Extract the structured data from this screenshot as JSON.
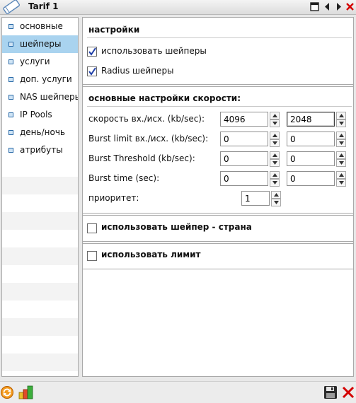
{
  "window": {
    "title": "Tarif 1",
    "icons": [
      "pencil-icon",
      "restore-icon",
      "prev-icon",
      "next-icon",
      "close-icon"
    ]
  },
  "sidebar": {
    "items": [
      {
        "label": "основные",
        "selected": false
      },
      {
        "label": "шейперы",
        "selected": true
      },
      {
        "label": "услуги",
        "selected": false
      },
      {
        "label": "доп. услуги",
        "selected": false
      },
      {
        "label": "NAS шейперы",
        "selected": false
      },
      {
        "label": "IP Pools",
        "selected": false
      },
      {
        "label": "день/ночь",
        "selected": false
      },
      {
        "label": "атрибуты",
        "selected": false
      }
    ]
  },
  "settings": {
    "title": "настройки",
    "use_shapers": {
      "label": "использовать шейперы",
      "checked": true
    },
    "radius_shapers": {
      "label": "Radius шейперы",
      "checked": true
    }
  },
  "speed": {
    "title": "основные настройки скорости:",
    "rows": [
      {
        "label": "скорость вх./исх. (kb/sec):",
        "in": "4096",
        "out": "2048"
      },
      {
        "label": "Burst limit вх./исх. (kb/sec):",
        "in": "0",
        "out": "0"
      },
      {
        "label": "Burst Threshold (kb/sec):",
        "in": "0",
        "out": "0"
      },
      {
        "label": "Burst time (sec):",
        "in": "0",
        "out": "0"
      }
    ],
    "priority": {
      "label": "приоритет:",
      "value": "1"
    }
  },
  "country_shaper": {
    "label": "использовать шейпер - страна",
    "checked": false
  },
  "limit": {
    "label": "использовать лимит",
    "checked": false
  },
  "toolbar": {
    "icons": [
      "refresh-icon",
      "chart-icon",
      "save-icon",
      "cancel-icon"
    ]
  },
  "colors": {
    "selected_row": "#a9d3ef",
    "check_mark": "#1f3fa8",
    "close_red": "#d40000"
  }
}
